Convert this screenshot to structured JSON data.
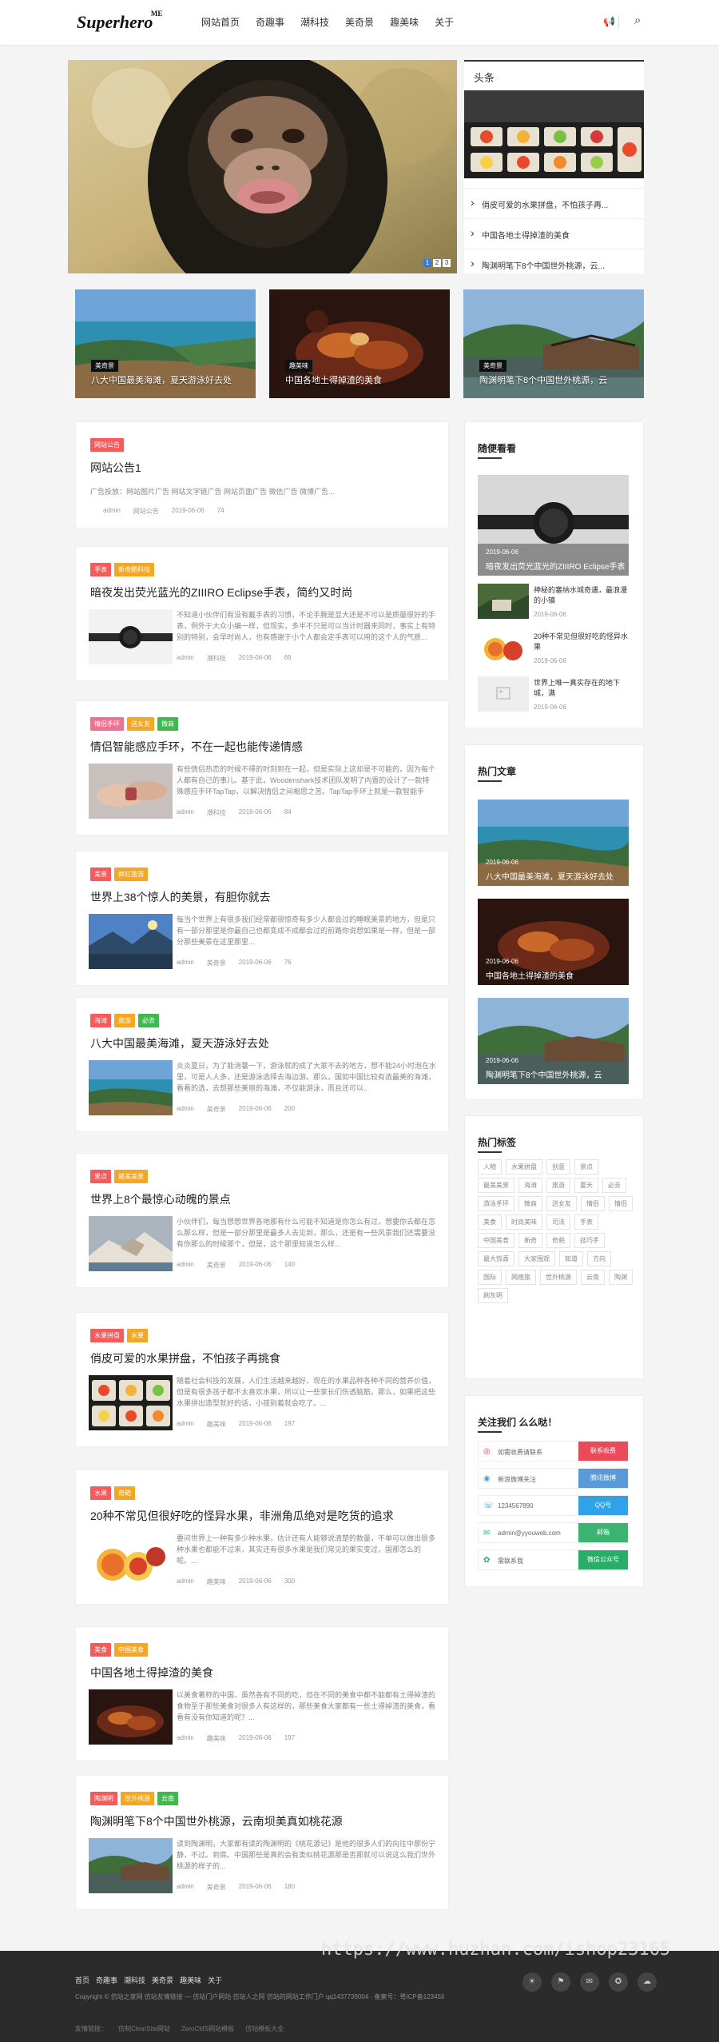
{
  "header": {
    "logo": "Superhero",
    "logo_sup": "ME",
    "nav": [
      "网站首页",
      "奇趣事",
      "潮科技",
      "美奇景",
      "趣美味",
      "关于"
    ],
    "bell_glyph": "📢",
    "search_glyph": "⌕"
  },
  "slider": {
    "pages": [
      "1",
      "2",
      "3"
    ]
  },
  "headline": {
    "title": "头条",
    "items": [
      "俏皮可爱的水果拼盘，不怕孩子再...",
      "中国各地土得掉渣的美食",
      "陶渊明笔下8个中国世外桃源，云..."
    ]
  },
  "featured": [
    {
      "tag": "美奇景",
      "title": "八大中国最美海滩，夏天游泳好去处"
    },
    {
      "tag": "趣美味",
      "title": "中国各地土得掉渣的美食"
    },
    {
      "tag": "美奇景",
      "title": "陶渊明笔下8个中国世外桃源，云"
    }
  ],
  "notice": {
    "tag": "网站公告",
    "title": "网站公告1",
    "excerpt": "广告投放：网站图片广告 网站文字链广告 网站页面广告 微信广告 微博广告...",
    "author": "admin",
    "category": "网站公告",
    "date": "2019-06-06",
    "views": "74"
  },
  "articles": [
    {
      "tags": [
        "手表",
        "新奇酷科技"
      ],
      "title": "暗夜发出荧光蓝光的ZIIIRO Eclipse手表，简约又时尚",
      "excerpt": "不知道小伙伴们有没有戴手表的习惯，不论手腕是显大还是不可以是质量很好的手表，例外于大众小编一样，但现实，多半不只是可以当计时器来同时，事实上有特别的特别，会早时尚人，也有感谢于小个人都会定手表可以用的这个人的气质...",
      "author": "admin",
      "category": "潮科技",
      "date": "2019-06-06",
      "views": "69"
    },
    {
      "tags": [
        "情侣手环",
        "送女友",
        "微商"
      ],
      "title": "情侣智能感应手环，不在一起也能传递情感",
      "excerpt": "有些情侣热恋的时候不得的时刻到在一起，但是实际上这却是不可能的，因为每个人都有自己的事儿。基于此，Woodenshark技术团队发明了内置的设计了一款特殊感应手环TapTap，以解决情侣之间相思之苦。TapTap手环上就是一款智能手环...",
      "author": "admin",
      "category": "潮科技",
      "date": "2019-06-06",
      "views": "84"
    },
    {
      "tags": [
        "美景",
        "疯狂旅游"
      ],
      "title": "世界上38个惊人的美景，有胆你就去",
      "excerpt": "每当个世界上有很多我们经常都很惊奇有多少人都会过的睡眠美景的地方，但是只有一部分那里是你最自己也都变成不成都会过的前路你说想如果是一样，但是一部分那些美景在这里那里...",
      "author": "admin",
      "category": "美奇景",
      "date": "2019-06-06",
      "views": "76"
    },
    {
      "tags": [
        "海滩",
        "旅游",
        "必去"
      ],
      "title": "八大中国最美海滩，夏天游泳好去处",
      "excerpt": "炎炎夏日，为了能消暑一下，游泳就的成了大家不去的地方，想不能24小时泡在水里，可是人人多，还是游泳选择去海边游。那么，国如中国比较有选最美的海滩，看看的选，去想那些美丽的海滩，不仅能游泳，而且还可以..",
      "author": "admin",
      "category": "美奇景",
      "date": "2019-06-06",
      "views": "200"
    },
    {
      "tags": [
        "景点",
        "最美美景"
      ],
      "title": "世界上8个最惊心动魄的景点",
      "excerpt": "小伙伴们，每当想想世界各地那有什么可能不知道是你怎么有过，想要你去都在怎么那么样，但是一部分那里是最多人去见到，那么，还是有一些风景我们还需要没有你那么的时候那个，但是，这个那里知道怎么样...",
      "author": "admin",
      "category": "美奇景",
      "date": "2019-06-06",
      "views": "140"
    },
    {
      "tags": [
        "水果拼盘",
        "水果"
      ],
      "title": "俏皮可爱的水果拼盘，不怕孩子再挑食",
      "excerpt": "随着社会科技的发展，人们生活越来越好，现在的水果品种各种不同的营养价值，但是有很多孩子都不太喜欢水果，所以让一些家长们伤透脑筋。那么，如果把这些水果拼出造型就好的话，小孩别着就会吃了。...",
      "author": "admin",
      "category": "趣美味",
      "date": "2019-06-06",
      "views": "197"
    },
    {
      "tags": [
        "水果",
        "奇葩"
      ],
      "title": "20种不常见但很好吃的怪异水果，非洲角瓜绝对是吃货的追求",
      "excerpt": "要问世界上一种有多少种水果，估计还有人能够说清楚的数量，不单可以做出很多种水果也都能不过来，其实还有很多水果是我们常见的果实变过，国那怎么的呢。...",
      "author": "admin",
      "category": "趣美味",
      "date": "2019-06-06",
      "views": "300"
    },
    {
      "tags": [
        "美食",
        "中国美食"
      ],
      "title": "中国各地土得掉渣的美食",
      "excerpt": "以美食著称的中国，虽然各有不同的吃，但在不同的美食中都不能都有土得掉渣的食物至于那些美食对很多人有这样的，那些美食大家都有一些土得掉渣的美食，看看有没有你知道的呢？...",
      "author": "admin",
      "category": "趣美味",
      "date": "2019-06-06",
      "views": "197"
    },
    {
      "tags": [
        "陶渊明",
        "世外桃源",
        "云南"
      ],
      "title": "陶渊明笔下8个中国世外桃源，云南坝美真如桃花源",
      "excerpt": "读到陶渊明，大家都有读的陶渊明的《桃花源记》是他的很多人们的向往中那份宁静，不过。到底。中国那些是真的会有类似桃花源那是否那就可以说这么我们世外桃源的样子的...",
      "author": "admin",
      "category": "美奇景",
      "date": "2019-06-06",
      "views": "180"
    }
  ],
  "recommend": {
    "title": "随便看看",
    "big": {
      "date": "2019-06-06",
      "title": "暗夜发出荧光蓝光的ZIIIRO Eclipse手表"
    },
    "items": [
      {
        "title": "神秘的塞纳水城奇遇，最浪漫的小镇",
        "date": "2019-06-06"
      },
      {
        "title": "20种不常见但很好吃的怪异水果",
        "date": "2019-06-06"
      },
      {
        "title": "世界上唯一真实存在的地下城，满",
        "date": "2019-06-06"
      }
    ]
  },
  "hot": {
    "title": "热门文章",
    "items": [
      {
        "date": "2019-06-06",
        "title": "八大中国最美海滩，夏天游泳好去处"
      },
      {
        "date": "2019-06-06",
        "title": "中国各地土得掉渣的美食"
      },
      {
        "date": "2019-06-06",
        "title": "陶渊明笔下8个中国世外桃源，云"
      }
    ]
  },
  "tags": {
    "title": "热门标签",
    "items": [
      "人物",
      "水果拼盘",
      "创意",
      "景点",
      "最美美景",
      "海滩",
      "旅游",
      "夏天",
      "必去",
      "游泳手环",
      "微商",
      "送女友",
      "情侣",
      "情侣",
      "美食",
      "时尚美味",
      "司法",
      "手表",
      "中国美食",
      "新奇",
      "奇葩",
      "技巧手",
      "最大惊喜",
      "大家围观",
      "知道",
      "方向",
      "国际",
      "网络旅",
      "世外桃源",
      "云南",
      "陶渊",
      "刷灰明"
    ]
  },
  "follow": {
    "title": "关注我们 么么哒！",
    "items": [
      {
        "icon": "◎",
        "label": "如需收费请联系",
        "btn": "联系收费",
        "color": "#e94b5a"
      },
      {
        "icon": "◉",
        "label": "新浪微博关注",
        "btn": "腾讯微博",
        "color": "#5b9ad8"
      },
      {
        "icon": "☏",
        "label": "1234567890",
        "btn": "QQ号",
        "color": "#2fa3e6"
      },
      {
        "icon": "✉",
        "label": "admin@yyouweb.com",
        "btn": "邮箱",
        "color": "#3cb371"
      },
      {
        "icon": "✿",
        "label": "需联系我",
        "btn": "微信公众号",
        "color": "#2aae67"
      }
    ]
  },
  "footer": {
    "nav": [
      "首页",
      "奇趣事",
      "潮科技",
      "美奇景",
      "趣美味",
      "关于"
    ],
    "copyright": "Copyright © 仿站之家网 仿站友情链接 — 仿站门户网站 仿站人之网 仿站的网站工作门户 qq1437739004 · 备案号：粤ICP备123456",
    "links": [
      "友情链接：",
      "仿制ClearSite网站",
      "ZeroCMS网站模板",
      "仿站模板大全"
    ],
    "icons": [
      "☀",
      "⚑",
      "✉",
      "✪",
      "☁"
    ]
  },
  "watermark": "https://www.huzhan.com/ishop23165"
}
